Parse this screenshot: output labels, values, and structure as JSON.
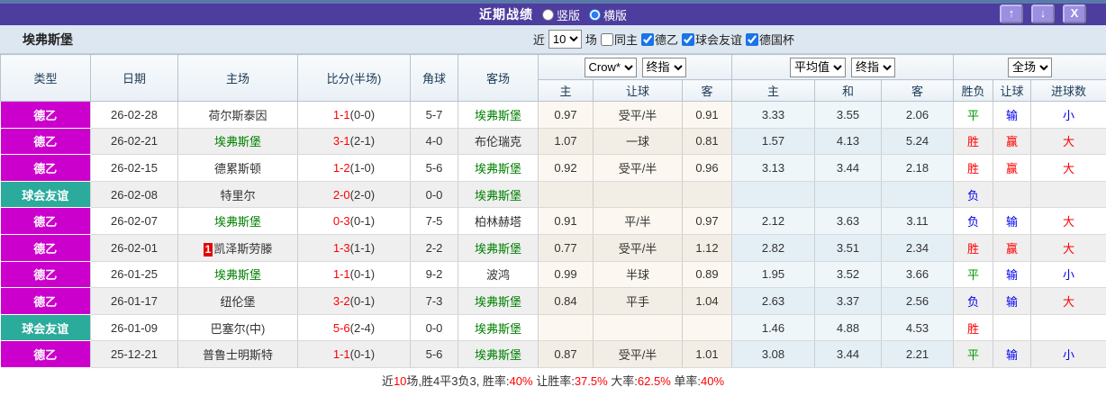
{
  "titlebar": {
    "title": "近期战绩",
    "radio_vertical": "竖版",
    "radio_horizontal": "横版",
    "vertical_selected": false,
    "horizontal_selected": true,
    "buttons": {
      "up": "↑",
      "down": "↓",
      "close": "X"
    }
  },
  "filterbar": {
    "team": "埃弗斯堡",
    "near_label": "近",
    "match_count": "10",
    "games_label": "场",
    "checkboxes": [
      {
        "label": "同主",
        "checked": false
      },
      {
        "label": "德乙",
        "checked": true
      },
      {
        "label": "球会友谊",
        "checked": true
      },
      {
        "label": "德国杯",
        "checked": true
      }
    ]
  },
  "table": {
    "selects": {
      "crow": "Crow*",
      "final1": "终指",
      "avg": "平均值",
      "final2": "终指",
      "full": "全场"
    },
    "headers": {
      "main": [
        "类型",
        "日期",
        "主场",
        "比分(半场)",
        "角球",
        "客场"
      ],
      "sub": [
        "主",
        "让球",
        "客",
        "主",
        "和",
        "客",
        "胜负",
        "让球",
        "进球数"
      ]
    },
    "rows": [
      {
        "type": "德乙",
        "type_key": "league",
        "date": "26-02-28",
        "home": "荷尔斯泰因",
        "home_green": false,
        "home_badge": "",
        "score": "1-1",
        "half": "(0-0)",
        "corner": "5-7",
        "away": "埃弗斯堡",
        "away_green": true,
        "crow": [
          "0.97",
          "受平/半",
          "0.91"
        ],
        "avg": [
          "3.33",
          "3.55",
          "2.06"
        ],
        "res": [
          [
            "平",
            "g"
          ],
          [
            "输",
            "b"
          ],
          [
            "小",
            "b"
          ]
        ]
      },
      {
        "type": "德乙",
        "type_key": "league",
        "date": "26-02-21",
        "home": "埃弗斯堡",
        "home_green": true,
        "home_badge": "",
        "score": "3-1",
        "half": "(2-1)",
        "corner": "4-0",
        "away": "布伦瑞克",
        "away_green": false,
        "crow": [
          "1.07",
          "一球",
          "0.81"
        ],
        "avg": [
          "1.57",
          "4.13",
          "5.24"
        ],
        "res": [
          [
            "胜",
            "r"
          ],
          [
            "赢",
            "r"
          ],
          [
            "大",
            "r"
          ]
        ]
      },
      {
        "type": "德乙",
        "type_key": "league",
        "date": "26-02-15",
        "home": "德累斯顿",
        "home_green": false,
        "home_badge": "",
        "score": "1-2",
        "half": "(1-0)",
        "corner": "5-6",
        "away": "埃弗斯堡",
        "away_green": true,
        "crow": [
          "0.92",
          "受平/半",
          "0.96"
        ],
        "avg": [
          "3.13",
          "3.44",
          "2.18"
        ],
        "res": [
          [
            "胜",
            "r"
          ],
          [
            "赢",
            "r"
          ],
          [
            "大",
            "r"
          ]
        ]
      },
      {
        "type": "球会友谊",
        "type_key": "friendly",
        "date": "26-02-08",
        "home": "特里尔",
        "home_green": false,
        "home_badge": "",
        "score": "2-0",
        "half": "(2-0)",
        "corner": "0-0",
        "away": "埃弗斯堡",
        "away_green": true,
        "crow": [
          "",
          "",
          ""
        ],
        "avg": [
          "",
          "",
          ""
        ],
        "res": [
          [
            "负",
            "b"
          ],
          [
            "",
            ""
          ],
          [
            "",
            ""
          ]
        ]
      },
      {
        "type": "德乙",
        "type_key": "league",
        "date": "26-02-07",
        "home": "埃弗斯堡",
        "home_green": true,
        "home_badge": "",
        "score": "0-3",
        "half": "(0-1)",
        "corner": "7-5",
        "away": "柏林赫塔",
        "away_green": false,
        "crow": [
          "0.91",
          "平/半",
          "0.97"
        ],
        "avg": [
          "2.12",
          "3.63",
          "3.11"
        ],
        "res": [
          [
            "负",
            "b"
          ],
          [
            "输",
            "b"
          ],
          [
            "大",
            "r"
          ]
        ]
      },
      {
        "type": "德乙",
        "type_key": "league",
        "date": "26-02-01",
        "home": "凯泽斯劳滕",
        "home_green": false,
        "home_badge": "1",
        "score": "1-3",
        "half": "(1-1)",
        "corner": "2-2",
        "away": "埃弗斯堡",
        "away_green": true,
        "crow": [
          "0.77",
          "受平/半",
          "1.12"
        ],
        "avg": [
          "2.82",
          "3.51",
          "2.34"
        ],
        "res": [
          [
            "胜",
            "r"
          ],
          [
            "赢",
            "r"
          ],
          [
            "大",
            "r"
          ]
        ]
      },
      {
        "type": "德乙",
        "type_key": "league",
        "date": "26-01-25",
        "home": "埃弗斯堡",
        "home_green": true,
        "home_badge": "",
        "score": "1-1",
        "half": "(0-1)",
        "corner": "9-2",
        "away": "波鸿",
        "away_green": false,
        "crow": [
          "0.99",
          "半球",
          "0.89"
        ],
        "avg": [
          "1.95",
          "3.52",
          "3.66"
        ],
        "res": [
          [
            "平",
            "g"
          ],
          [
            "输",
            "b"
          ],
          [
            "小",
            "b"
          ]
        ]
      },
      {
        "type": "德乙",
        "type_key": "league",
        "date": "26-01-17",
        "home": "纽伦堡",
        "home_green": false,
        "home_badge": "",
        "score": "3-2",
        "half": "(0-1)",
        "corner": "7-3",
        "away": "埃弗斯堡",
        "away_green": true,
        "crow": [
          "0.84",
          "平手",
          "1.04"
        ],
        "avg": [
          "2.63",
          "3.37",
          "2.56"
        ],
        "res": [
          [
            "负",
            "b"
          ],
          [
            "输",
            "b"
          ],
          [
            "大",
            "r"
          ]
        ]
      },
      {
        "type": "球会友谊",
        "type_key": "friendly",
        "date": "26-01-09",
        "home": "巴塞尔(中)",
        "home_green": false,
        "home_badge": "",
        "score": "5-6",
        "half": "(2-4)",
        "corner": "0-0",
        "away": "埃弗斯堡",
        "away_green": true,
        "crow": [
          "",
          "",
          ""
        ],
        "avg": [
          "1.46",
          "4.88",
          "4.53"
        ],
        "res": [
          [
            "胜",
            "r"
          ],
          [
            "",
            ""
          ],
          [
            "",
            ""
          ]
        ]
      },
      {
        "type": "德乙",
        "type_key": "league",
        "date": "25-12-21",
        "home": "普鲁士明斯特",
        "home_green": false,
        "home_badge": "",
        "score": "1-1",
        "half": "(0-1)",
        "corner": "5-6",
        "away": "埃弗斯堡",
        "away_green": true,
        "crow": [
          "0.87",
          "受平/半",
          "1.01"
        ],
        "avg": [
          "3.08",
          "3.44",
          "2.21"
        ],
        "res": [
          [
            "平",
            "g"
          ],
          [
            "输",
            "b"
          ],
          [
            "小",
            "b"
          ]
        ]
      }
    ]
  },
  "summary": {
    "parts": [
      [
        "近",
        false
      ],
      [
        "10",
        true
      ],
      [
        "场,胜4平3负3, 胜率:",
        false
      ],
      [
        "40%",
        true
      ],
      [
        " 让胜率:",
        false
      ],
      [
        "37.5%",
        true
      ],
      [
        " 大率:",
        false
      ],
      [
        "62.5%",
        true
      ],
      [
        " 单率:",
        false
      ],
      [
        "40%",
        true
      ]
    ]
  },
  "colors": {
    "type": {
      "league": "#cc00cc",
      "friendly": "#2aab9b"
    },
    "res": {
      "r": "c-r",
      "g": "c-g",
      "b": "c-b"
    },
    "accent_purple": "#4c3d9e",
    "strip_blue": "#5b79a8",
    "team_green": "#008000",
    "score_red": "#ff0000"
  }
}
